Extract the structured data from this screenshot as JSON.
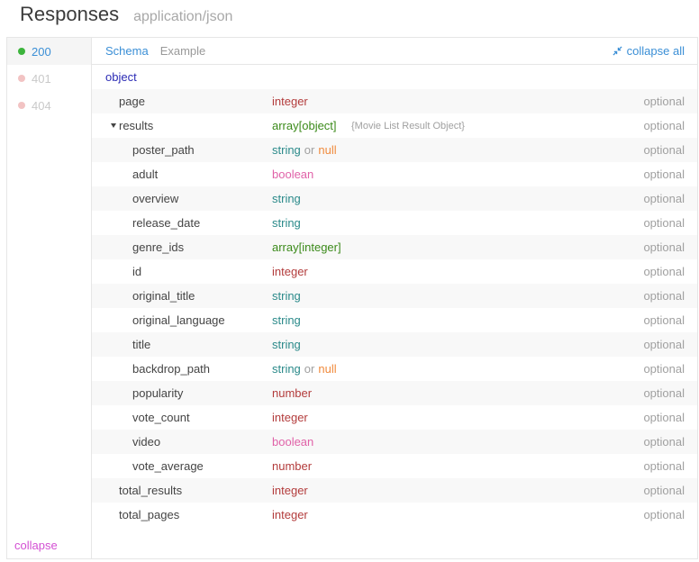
{
  "header": {
    "title": "Responses",
    "subtitle": "application/json"
  },
  "codes": [
    {
      "code": "200",
      "active": true
    },
    {
      "code": "401",
      "active": false
    },
    {
      "code": "404",
      "active": false
    }
  ],
  "tabs": [
    {
      "label": "Schema",
      "active": true
    },
    {
      "label": "Example",
      "active": false
    }
  ],
  "collapse_all_label": "collapse all",
  "root_type": "object",
  "rows": [
    {
      "name": "page",
      "level": 1,
      "types": [
        {
          "t": "integer",
          "cls": "integer"
        }
      ],
      "optional": "optional"
    },
    {
      "name": "results",
      "level": 1,
      "expanded": true,
      "types": [
        {
          "t": "array[object]",
          "cls": "array"
        }
      ],
      "extra": "{Movie List Result Object}",
      "optional": "optional"
    },
    {
      "name": "poster_path",
      "level": 2,
      "types": [
        {
          "t": "string",
          "cls": "string"
        },
        {
          "t": "or",
          "cls": "or"
        },
        {
          "t": "null",
          "cls": "null"
        }
      ],
      "optional": "optional"
    },
    {
      "name": "adult",
      "level": 2,
      "types": [
        {
          "t": "boolean",
          "cls": "boolean"
        }
      ],
      "optional": "optional"
    },
    {
      "name": "overview",
      "level": 2,
      "types": [
        {
          "t": "string",
          "cls": "string"
        }
      ],
      "optional": "optional"
    },
    {
      "name": "release_date",
      "level": 2,
      "types": [
        {
          "t": "string",
          "cls": "string"
        }
      ],
      "optional": "optional"
    },
    {
      "name": "genre_ids",
      "level": 2,
      "types": [
        {
          "t": "array[integer]",
          "cls": "array"
        }
      ],
      "optional": "optional"
    },
    {
      "name": "id",
      "level": 2,
      "types": [
        {
          "t": "integer",
          "cls": "integer"
        }
      ],
      "optional": "optional"
    },
    {
      "name": "original_title",
      "level": 2,
      "types": [
        {
          "t": "string",
          "cls": "string"
        }
      ],
      "optional": "optional"
    },
    {
      "name": "original_language",
      "level": 2,
      "types": [
        {
          "t": "string",
          "cls": "string"
        }
      ],
      "optional": "optional"
    },
    {
      "name": "title",
      "level": 2,
      "types": [
        {
          "t": "string",
          "cls": "string"
        }
      ],
      "optional": "optional"
    },
    {
      "name": "backdrop_path",
      "level": 2,
      "types": [
        {
          "t": "string",
          "cls": "string"
        },
        {
          "t": "or",
          "cls": "or"
        },
        {
          "t": "null",
          "cls": "null"
        }
      ],
      "optional": "optional"
    },
    {
      "name": "popularity",
      "level": 2,
      "types": [
        {
          "t": "number",
          "cls": "number"
        }
      ],
      "optional": "optional"
    },
    {
      "name": "vote_count",
      "level": 2,
      "types": [
        {
          "t": "integer",
          "cls": "integer"
        }
      ],
      "optional": "optional"
    },
    {
      "name": "video",
      "level": 2,
      "types": [
        {
          "t": "boolean",
          "cls": "boolean"
        }
      ],
      "optional": "optional"
    },
    {
      "name": "vote_average",
      "level": 2,
      "types": [
        {
          "t": "number",
          "cls": "number"
        }
      ],
      "optional": "optional"
    },
    {
      "name": "total_results",
      "level": 1,
      "types": [
        {
          "t": "integer",
          "cls": "integer"
        }
      ],
      "optional": "optional"
    },
    {
      "name": "total_pages",
      "level": 1,
      "types": [
        {
          "t": "integer",
          "cls": "integer"
        }
      ],
      "optional": "optional"
    }
  ],
  "collapse_label": "collapse",
  "colors": {
    "accent": "#3b8fd6",
    "integer": "#b33c3c",
    "string": "#2b8a8a",
    "array": "#3b8a1a",
    "boolean": "#e062a8",
    "null": "#f08a3c",
    "success_dot": "#3cb43c",
    "collapse_link": "#d34fd3"
  }
}
